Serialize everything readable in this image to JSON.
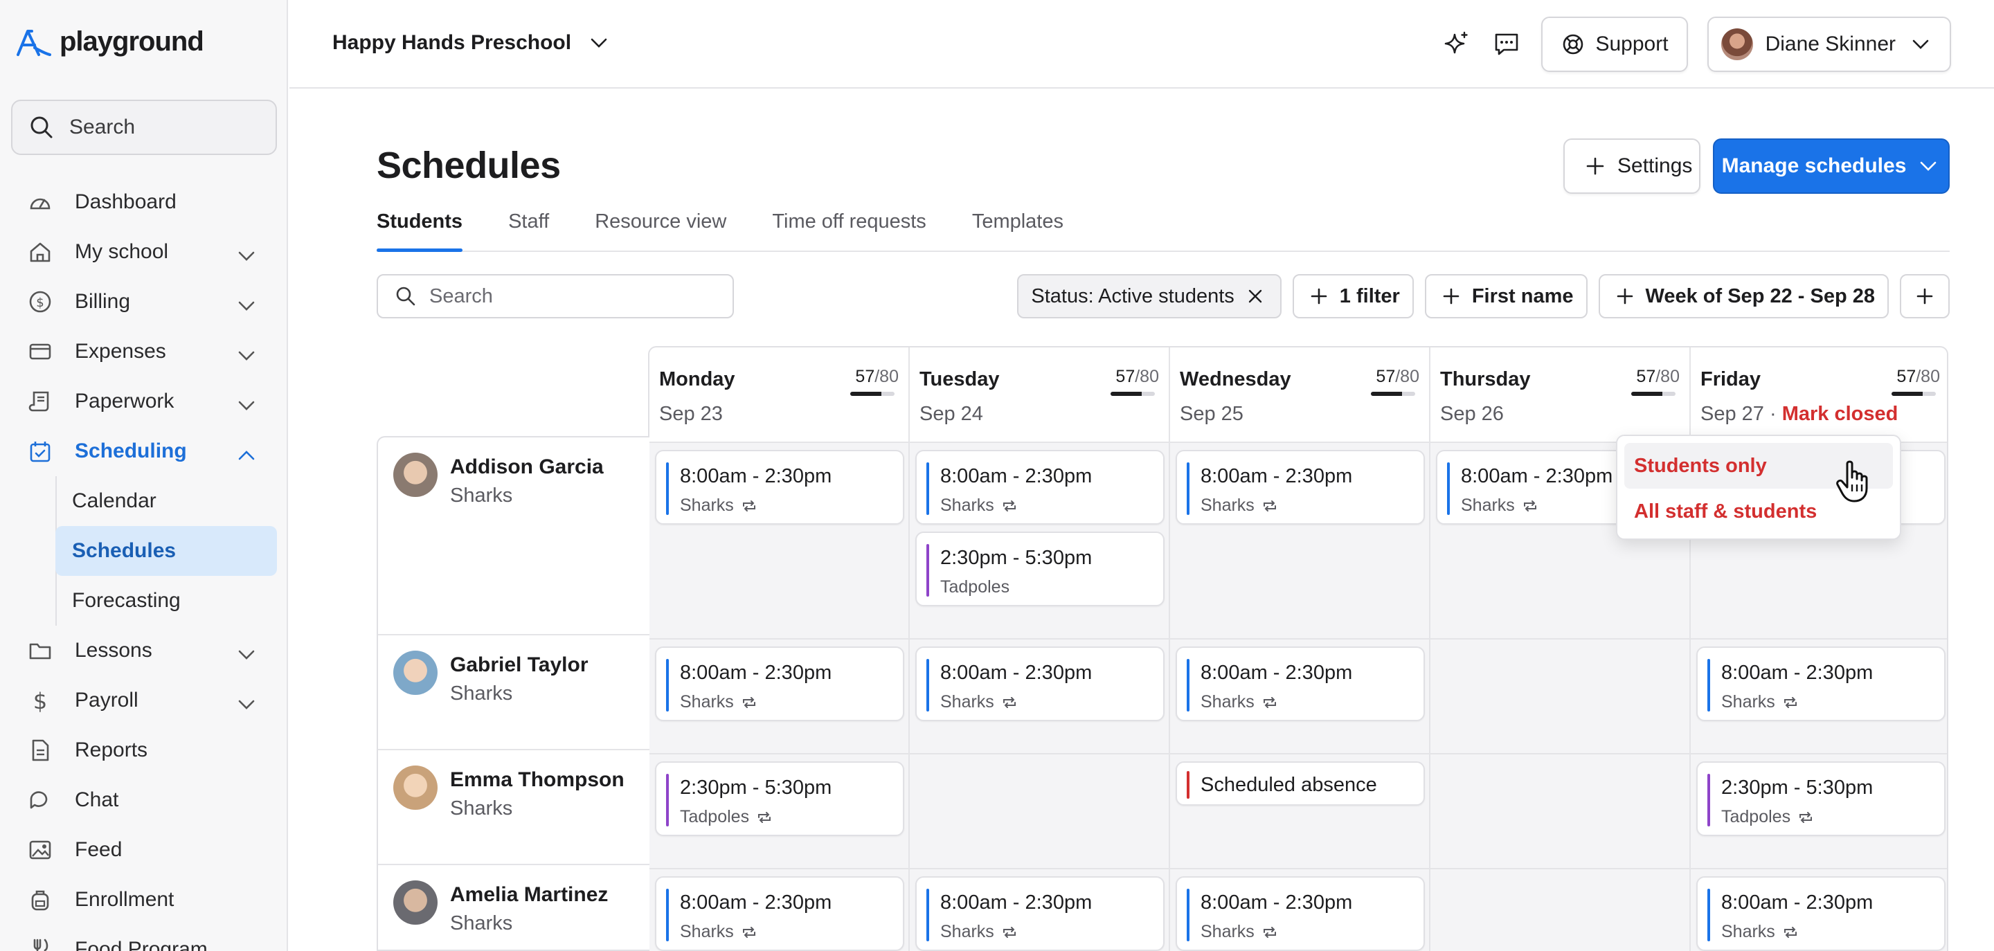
{
  "brand": {
    "name": "playground"
  },
  "sidebar": {
    "search_label": "Search",
    "items": [
      {
        "label": "Dashboard",
        "icon": "gauge-icon",
        "expandable": false
      },
      {
        "label": "My school",
        "icon": "home-icon",
        "expandable": true
      },
      {
        "label": "Billing",
        "icon": "dollar-circle-icon",
        "expandable": true
      },
      {
        "label": "Expenses",
        "icon": "credit-card-icon",
        "expandable": true
      },
      {
        "label": "Paperwork",
        "icon": "scroll-icon",
        "expandable": true
      },
      {
        "label": "Scheduling",
        "icon": "calendar-check-icon",
        "expandable": true,
        "active": true
      },
      {
        "label": "Lessons",
        "icon": "folder-icon",
        "expandable": true
      },
      {
        "label": "Payroll",
        "icon": "dollar-icon",
        "expandable": true
      },
      {
        "label": "Reports",
        "icon": "document-icon",
        "expandable": false
      },
      {
        "label": "Chat",
        "icon": "chat-icon",
        "expandable": false
      },
      {
        "label": "Feed",
        "icon": "image-icon",
        "expandable": false
      },
      {
        "label": "Enrollment",
        "icon": "backpack-icon",
        "expandable": false
      },
      {
        "label": "Food Program",
        "icon": "fork-icon",
        "expandable": false
      }
    ],
    "scheduling_sub": [
      {
        "label": "Calendar"
      },
      {
        "label": "Schedules",
        "active": true
      },
      {
        "label": "Forecasting"
      }
    ]
  },
  "topbar": {
    "school_name": "Happy Hands Preschool",
    "support_label": "Support",
    "user_name": "Diane Skinner"
  },
  "page": {
    "title": "Schedules",
    "settings_label": "Settings",
    "manage_label": "Manage schedules",
    "tabs": [
      {
        "label": "Students",
        "active": true
      },
      {
        "label": "Staff"
      },
      {
        "label": "Resource view"
      },
      {
        "label": "Time off requests"
      },
      {
        "label": "Templates"
      }
    ],
    "search_placeholder": "Search",
    "filters": {
      "status": "Status: Active students",
      "filter_count": "1 filter",
      "first_name": "First name",
      "week": "Week of Sep 22 - Sep 28"
    }
  },
  "days": [
    {
      "name": "Monday",
      "date": "Sep 23",
      "count": "57",
      "capacity": "/80",
      "fill": 0.71
    },
    {
      "name": "Tuesday",
      "date": "Sep 24",
      "count": "57",
      "capacity": "/80",
      "fill": 0.71
    },
    {
      "name": "Wednesday",
      "date": "Sep 25",
      "count": "57",
      "capacity": "/80",
      "fill": 0.71
    },
    {
      "name": "Thursday",
      "date": "Sep 26",
      "count": "57",
      "capacity": "/80",
      "fill": 0.71
    },
    {
      "name": "Friday",
      "date": "Sep 27",
      "count": "57",
      "capacity": "/80",
      "fill": 0.71,
      "separator": " · ",
      "action": "Mark closed"
    }
  ],
  "students": [
    {
      "name": "Addison Garcia",
      "group": "Sharks"
    },
    {
      "name": "Gabriel Taylor",
      "group": "Sharks"
    },
    {
      "name": "Emma Thompson",
      "group": "Sharks"
    },
    {
      "name": "Amelia Martinez",
      "group": "Sharks"
    }
  ],
  "dropdown": {
    "items": [
      {
        "label": "Students only"
      },
      {
        "label": "All staff & students"
      }
    ]
  },
  "schedule": {
    "full_day": "8:00am - 2:30pm",
    "afternoon": "2:30pm - 5:30pm",
    "absence": "Scheduled absence",
    "sharks": "Sharks",
    "tadpoles": "Tadpoles"
  },
  "colors": {
    "accent": "#1a73e8",
    "sharks_bar": "#1a73e8",
    "tadpoles_bar": "#8e44c9",
    "absence_bar": "#d32f2f",
    "danger": "#d32f2f"
  }
}
